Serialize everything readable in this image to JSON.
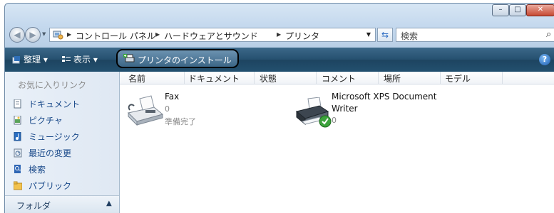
{
  "window": {
    "caption": {
      "minimize": "–",
      "maximize": "□",
      "close": "✕"
    }
  },
  "address": {
    "crumbs": [
      "コントロール パネル",
      "ハードウェアとサウンド",
      "プリンタ"
    ],
    "search_placeholder": "検索"
  },
  "toolbar": {
    "organize": "整理",
    "view": "表示",
    "install": "プリンタのインストール"
  },
  "sidebar": {
    "favorites_title": "お気に入りリンク",
    "items": [
      {
        "label": "ドキュメント",
        "icon": "document-icon"
      },
      {
        "label": "ピクチャ",
        "icon": "picture-icon"
      },
      {
        "label": "ミュージック",
        "icon": "music-icon"
      },
      {
        "label": "最近の変更",
        "icon": "recent-changes-icon"
      },
      {
        "label": "検索",
        "icon": "search-icon"
      },
      {
        "label": "パブリック",
        "icon": "public-folder-icon"
      }
    ],
    "folders_label": "フォルダ"
  },
  "columns": [
    "名前",
    "ドキュメント",
    "状態",
    "コメント",
    "場所",
    "モデル"
  ],
  "printers": [
    {
      "name": "Fax",
      "documents": "0",
      "status": "準備完了",
      "icon": "fax-icon"
    },
    {
      "name": "Microsoft XPS Document",
      "name_line2": "Writer",
      "documents": "0",
      "icon": "default-printer-icon"
    }
  ]
}
